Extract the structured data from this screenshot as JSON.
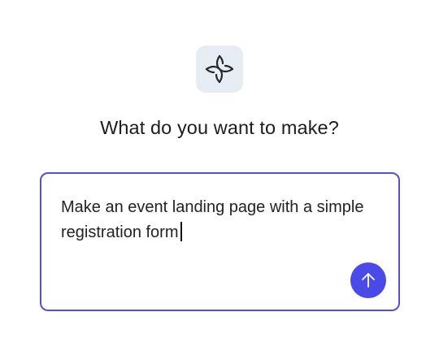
{
  "logo": {
    "icon": "sparkle-loop-icon"
  },
  "heading": "What do you want to make?",
  "prompt": {
    "value": "Make an event landing page with a simple registration form",
    "border_color": "#4f4ee6"
  },
  "send_button": {
    "icon": "arrow-up-icon",
    "color": "#4a4ae8"
  }
}
